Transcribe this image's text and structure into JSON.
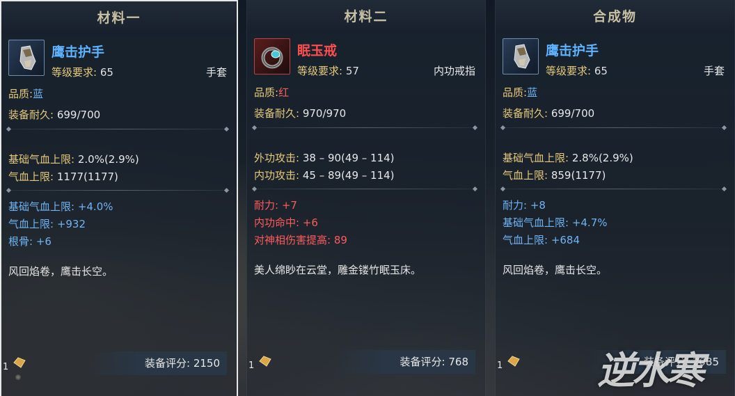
{
  "panels": [
    {
      "title": "材料一",
      "item_name": "鹰击护手",
      "req_label": "等级要求:",
      "req_value": "65",
      "slot": "手套",
      "quality_label": "品质:",
      "quality_value": "蓝",
      "durability_label": "装备耐久:",
      "durability_value": "699/700",
      "base_stats": [
        {
          "label": "基础气血上限:",
          "value": "2.0%(2.9%)"
        },
        {
          "label": "气血上限:",
          "value": "1177(1177)"
        }
      ],
      "extra_stats": [
        {
          "text": "基础气血上限: +4.0%"
        },
        {
          "text": "气血上限: +932"
        },
        {
          "text": "根骨: +6"
        }
      ],
      "flavor": "风回焰卷，鹰击长空。",
      "count": "1",
      "score": "装备评分: 2150"
    },
    {
      "title": "材料二",
      "item_name": "眠玉戒",
      "req_label": "等级要求:",
      "req_value": "57",
      "slot": "内功戒指",
      "quality_label": "品质:",
      "quality_value": "红",
      "durability_label": "装备耐久:",
      "durability_value": "970/970",
      "base_stats": [
        {
          "label": "外功攻击:",
          "value": "38 – 90(49 – 114)"
        },
        {
          "label": "内功攻击:",
          "value": "45 – 89(49 – 114)"
        }
      ],
      "extra_stats": [
        {
          "text": "耐力: +7"
        },
        {
          "text": "内功命中: +6"
        },
        {
          "text": "对神相伤害提高: 89"
        }
      ],
      "flavor": "美人绵眇在云堂，雕金镂竹眠玉床。",
      "count": "1",
      "score": "装备评分: 768"
    },
    {
      "title": "合成物",
      "item_name": "鹰击护手",
      "req_label": "等级要求:",
      "req_value": "65",
      "slot": "手套",
      "quality_label": "品质:",
      "quality_value": "蓝",
      "durability_label": "装备耐久:",
      "durability_value": "699/700",
      "base_stats": [
        {
          "label": "基础气血上限:",
          "value": "2.8%(2.9%)"
        },
        {
          "label": "气血上限:",
          "value": "859(1177)"
        }
      ],
      "extra_stats": [
        {
          "text": "耐力: +8"
        },
        {
          "text": "基础气血上限: +4.7%"
        },
        {
          "text": "气血上限: +684"
        }
      ],
      "flavor": "风回焰卷，鹰击长空。",
      "count": "1",
      "score": "装备评分: 2085"
    }
  ],
  "watermark": "逆水寒",
  "colors": {
    "gold_label": "#e6c97a",
    "blue_stat": "#6fb4f4",
    "red_stat": "#ff5b5b",
    "name_blue": "#5fb2ff",
    "name_red": "#ff4e4e"
  },
  "icons": [
    "gauntlet-icon",
    "ring-icon",
    "gauntlet-icon",
    "coin-icon"
  ]
}
